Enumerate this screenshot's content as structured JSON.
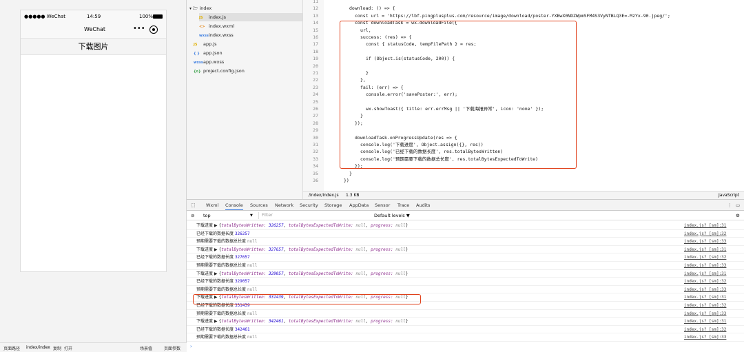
{
  "simulator": {
    "status_signal": "●●●●● WeChat",
    "status_time": "14:59",
    "status_battery": "100%",
    "nav_title": "WeChat",
    "nav_dots": "•••",
    "page_title": "下载图片",
    "footer": {
      "path_label": "页面路径",
      "path_value": "index/index",
      "copy": "复制",
      "open": "打开",
      "scene": "场景值",
      "params": "页面参数"
    }
  },
  "file_tree": {
    "folder": "index",
    "files": [
      {
        "name": "index.js",
        "icon": "JS",
        "color": "#e0b000"
      },
      {
        "name": "index.wxml",
        "icon": "<>",
        "color": "#e07a00"
      },
      {
        "name": "index.wxss",
        "icon": "wxss",
        "color": "#3a7ce0"
      },
      {
        "name": "app.js",
        "icon": "JS",
        "color": "#e0b000"
      },
      {
        "name": "app.json",
        "icon": "{ }",
        "color": "#3a7ce0"
      },
      {
        "name": "app.wxss",
        "icon": "wxss",
        "color": "#3a7ce0"
      },
      {
        "name": "project.config.json",
        "icon": "{o}",
        "color": "#3aa04a"
      }
    ]
  },
  "editor": {
    "lines": [
      {
        "n": "11",
        "indent": 0,
        "text": ""
      },
      {
        "n": "12",
        "indent": 4,
        "text": "download: () => {"
      },
      {
        "n": "13",
        "indent": 6,
        "text": "const url = 'https://lbf.pingplusplus.com/resource/image/download/poster-YXBwX0NDZWpmSFM4S3VyNTBLQ3E=-MzYx-90.jpeg/';"
      },
      {
        "n": "14",
        "indent": 6,
        "text": "const downloadTask = wx.downloadFile({"
      },
      {
        "n": "15",
        "indent": 8,
        "text": "url,"
      },
      {
        "n": "16",
        "indent": 8,
        "text": "success: (res) => {"
      },
      {
        "n": "17",
        "indent": 10,
        "text": "const { statusCode, tempFilePath } = res;"
      },
      {
        "n": "18",
        "indent": 0,
        "text": ""
      },
      {
        "n": "19",
        "indent": 10,
        "text": "if (Object.is(statusCode, 200)) {"
      },
      {
        "n": "20",
        "indent": 0,
        "text": ""
      },
      {
        "n": "21",
        "indent": 10,
        "text": "}"
      },
      {
        "n": "22",
        "indent": 8,
        "text": "},"
      },
      {
        "n": "23",
        "indent": 8,
        "text": "fail: (err) => {"
      },
      {
        "n": "24",
        "indent": 10,
        "text": "console.error('savePoster:', err);"
      },
      {
        "n": "25",
        "indent": 0,
        "text": ""
      },
      {
        "n": "26",
        "indent": 10,
        "text": "wx.showToast({ title: err.errMsg || '下载海报异常', icon: 'none' });"
      },
      {
        "n": "27",
        "indent": 8,
        "text": "}"
      },
      {
        "n": "28",
        "indent": 6,
        "text": "});"
      },
      {
        "n": "29",
        "indent": 0,
        "text": ""
      },
      {
        "n": "30",
        "indent": 6,
        "text": "downloadTask.onProgressUpdate(res => {"
      },
      {
        "n": "31",
        "indent": 8,
        "text": "console.log('下载进度', Object.assign({}, res))"
      },
      {
        "n": "32",
        "indent": 8,
        "text": "console.log('已经下载的数据长度', res.totalBytesWritten)"
      },
      {
        "n": "33",
        "indent": 8,
        "text": "console.log('预期需要下载的数据总长度', res.totalBytesExpectedToWrite)"
      },
      {
        "n": "34",
        "indent": 6,
        "text": "});"
      },
      {
        "n": "35",
        "indent": 4,
        "text": "}"
      },
      {
        "n": "36",
        "indent": 2,
        "text": "})"
      }
    ],
    "status": {
      "file": "/index/index.js",
      "size": "1.3 KB",
      "lang": "JavaScript"
    }
  },
  "devtools": {
    "tabs": [
      "Wxml",
      "Console",
      "Sources",
      "Network",
      "Security",
      "Storage",
      "AppData",
      "Sensor",
      "Trace",
      "Audits"
    ],
    "active_tab": "Console",
    "context": "top",
    "filter_placeholder": "Filter",
    "levels": "Default levels ▼"
  },
  "console": {
    "rows": [
      {
        "type": "obj",
        "label": "下载进度",
        "written": "326257",
        "src": "index.js? [sm]:31"
      },
      {
        "type": "num",
        "label": "已经下载的数据长度",
        "value": "326257",
        "src": "index.js? [sm]:32"
      },
      {
        "type": "null",
        "label": "预期需要下载的数据总长度",
        "value": "null",
        "src": "index.js? [sm]:33"
      },
      {
        "type": "obj",
        "label": "下载进度",
        "written": "327657",
        "src": "index.js? [sm]:31"
      },
      {
        "type": "num",
        "label": "已经下载的数据长度",
        "value": "327657",
        "src": "index.js? [sm]:32"
      },
      {
        "type": "null",
        "label": "预期需要下载的数据总长度",
        "value": "null",
        "src": "index.js? [sm]:33"
      },
      {
        "type": "obj",
        "label": "下载进度",
        "written": "329057",
        "src": "index.js? [sm]:31"
      },
      {
        "type": "num",
        "label": "已经下载的数据长度",
        "value": "329057",
        "src": "index.js? [sm]:32"
      },
      {
        "type": "null",
        "label": "预期需要下载的数据总长度",
        "value": "null",
        "src": "index.js? [sm]:33"
      },
      {
        "type": "obj",
        "label": "下载进度",
        "written": "331439",
        "src": "index.js? [sm]:31"
      },
      {
        "type": "num",
        "label": "已经下载的数据长度",
        "value": "331439",
        "src": "index.js? [sm]:32"
      },
      {
        "type": "null",
        "label": "预期需要下载的数据总长度",
        "value": "null",
        "src": "index.js? [sm]:33"
      },
      {
        "type": "obj",
        "label": "下载进度",
        "written": "342461",
        "src": "index.js? [sm]:31"
      },
      {
        "type": "num",
        "label": "已经下载的数据长度",
        "value": "342461",
        "src": "index.js? [sm]:32"
      },
      {
        "type": "null",
        "label": "预期需要下载的数据总长度",
        "value": "null",
        "src": "index.js? [sm]:33"
      }
    ],
    "obj_text": {
      "k1": "totalBytesWritten:",
      "k2": "totalBytesExpectedToWrite:",
      "k3": "progress:",
      "nullv": "null"
    },
    "prompt": "›"
  },
  "colors": {
    "highlight": "#e0401a",
    "accent": "#3a7ce0"
  }
}
